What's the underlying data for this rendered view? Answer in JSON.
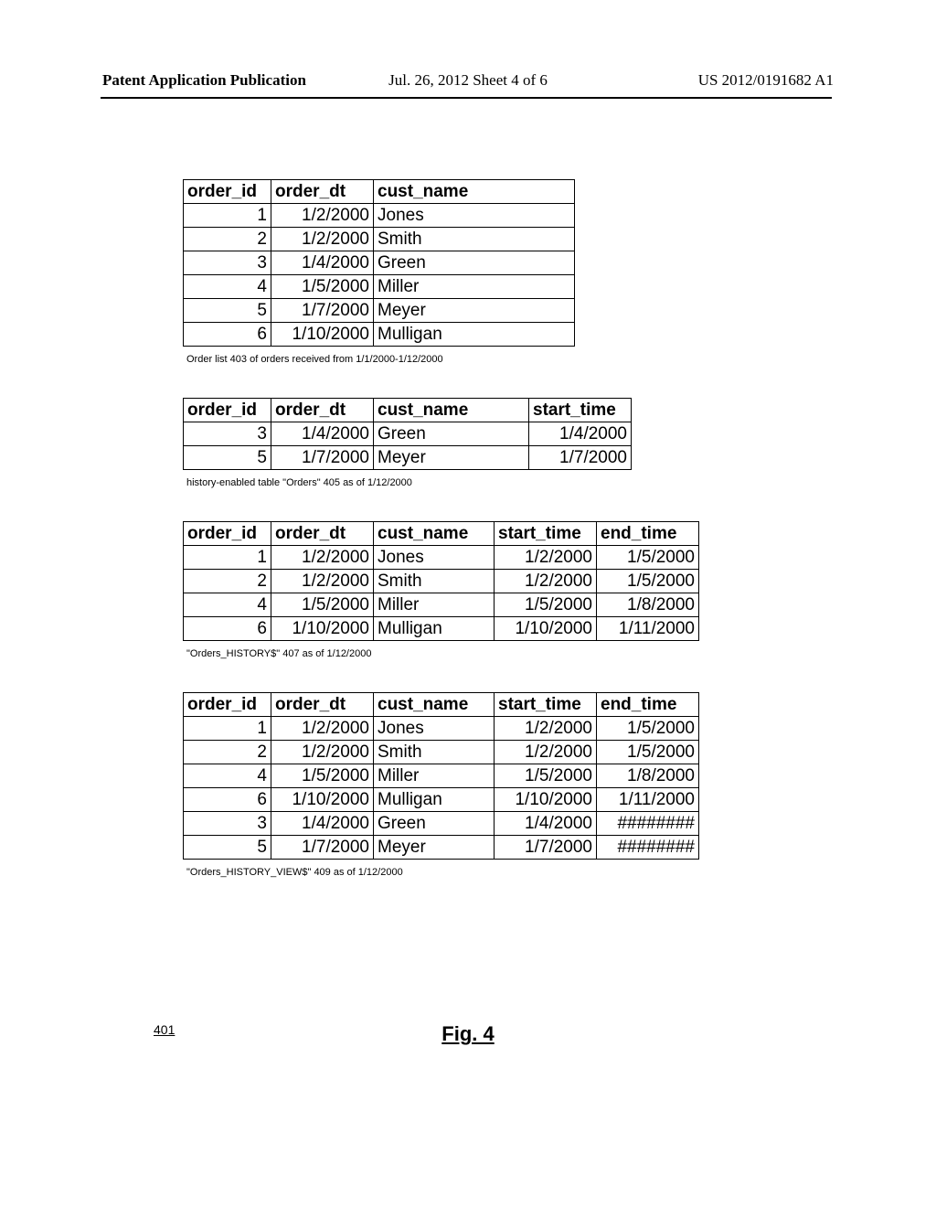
{
  "header": {
    "left": "Patent Application Publication",
    "center": "Jul. 26, 2012  Sheet 4 of 6",
    "right": "US 2012/0191682 A1"
  },
  "tables": {
    "orders_list": {
      "headers": [
        "order_id",
        "order_dt",
        "cust_name"
      ],
      "rows": [
        {
          "order_id": "1",
          "order_dt": "1/2/2000",
          "cust_name": "Jones"
        },
        {
          "order_id": "2",
          "order_dt": "1/2/2000",
          "cust_name": "Smith"
        },
        {
          "order_id": "3",
          "order_dt": "1/4/2000",
          "cust_name": "Green"
        },
        {
          "order_id": "4",
          "order_dt": "1/5/2000",
          "cust_name": "Miller"
        },
        {
          "order_id": "5",
          "order_dt": "1/7/2000",
          "cust_name": "Meyer"
        },
        {
          "order_id": "6",
          "order_dt": "1/10/2000",
          "cust_name": "Mulligan"
        }
      ],
      "caption": "Order list 403 of orders received from 1/1/2000-1/12/2000"
    },
    "history_enabled": {
      "headers": [
        "order_id",
        "order_dt",
        "cust_name",
        "start_time"
      ],
      "rows": [
        {
          "order_id": "3",
          "order_dt": "1/4/2000",
          "cust_name": "Green",
          "start_time": "1/4/2000"
        },
        {
          "order_id": "5",
          "order_dt": "1/7/2000",
          "cust_name": "Meyer",
          "start_time": "1/7/2000"
        }
      ],
      "caption": "history-enabled table \"Orders\" 405 as of 1/12/2000"
    },
    "orders_history": {
      "headers": [
        "order_id",
        "order_dt",
        "cust_name",
        "start_time",
        "end_time"
      ],
      "rows": [
        {
          "order_id": "1",
          "order_dt": "1/2/2000",
          "cust_name": "Jones",
          "start_time": "1/2/2000",
          "end_time": "1/5/2000"
        },
        {
          "order_id": "2",
          "order_dt": "1/2/2000",
          "cust_name": "Smith",
          "start_time": "1/2/2000",
          "end_time": "1/5/2000"
        },
        {
          "order_id": "4",
          "order_dt": "1/5/2000",
          "cust_name": "Miller",
          "start_time": "1/5/2000",
          "end_time": "1/8/2000"
        },
        {
          "order_id": "6",
          "order_dt": "1/10/2000",
          "cust_name": "Mulligan",
          "start_time": "1/10/2000",
          "end_time": "1/11/2000"
        }
      ],
      "caption": "\"Orders_HISTORY$\" 407 as of 1/12/2000"
    },
    "orders_history_view": {
      "headers": [
        "order_id",
        "order_dt",
        "cust_name",
        "start_time",
        "end_time"
      ],
      "rows": [
        {
          "order_id": "1",
          "order_dt": "1/2/2000",
          "cust_name": "Jones",
          "start_time": "1/2/2000",
          "end_time": "1/5/2000"
        },
        {
          "order_id": "2",
          "order_dt": "1/2/2000",
          "cust_name": "Smith",
          "start_time": "1/2/2000",
          "end_time": "1/5/2000"
        },
        {
          "order_id": "4",
          "order_dt": "1/5/2000",
          "cust_name": "Miller",
          "start_time": "1/5/2000",
          "end_time": "1/8/2000"
        },
        {
          "order_id": "6",
          "order_dt": "1/10/2000",
          "cust_name": "Mulligan",
          "start_time": "1/10/2000",
          "end_time": "1/11/2000"
        },
        {
          "order_id": "3",
          "order_dt": "1/4/2000",
          "cust_name": "Green",
          "start_time": "1/4/2000",
          "end_time": "########"
        },
        {
          "order_id": "5",
          "order_dt": "1/7/2000",
          "cust_name": "Meyer",
          "start_time": "1/7/2000",
          "end_time": "########"
        }
      ],
      "caption": "\"Orders_HISTORY_VIEW$\" 409 as of 1/12/2000"
    }
  },
  "figure": {
    "ref": "401",
    "title": "Fig. 4"
  }
}
